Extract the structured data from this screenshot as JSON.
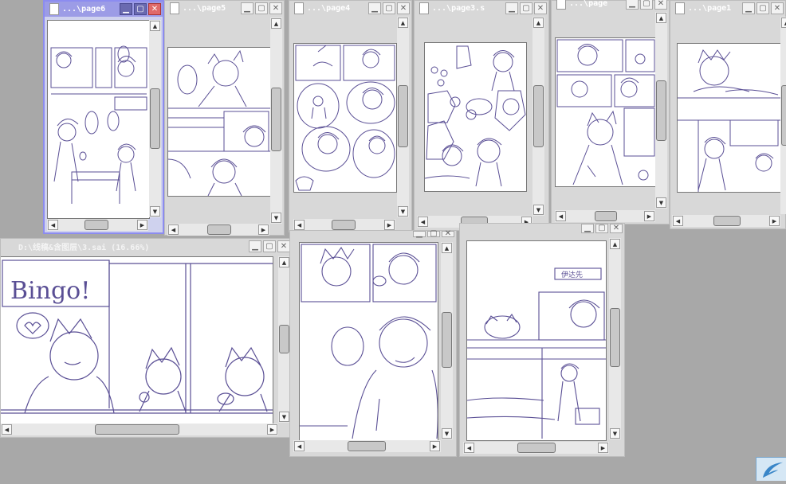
{
  "windows": [
    {
      "id": "page6",
      "title": "...\\page6",
      "active": true
    },
    {
      "id": "page5",
      "title": "...\\page5",
      "active": false
    },
    {
      "id": "page4",
      "title": "...\\page4",
      "active": false
    },
    {
      "id": "page3",
      "title": "...\\page3.s",
      "active": false
    },
    {
      "id": "page2",
      "title": "...\\page",
      "active": false
    },
    {
      "id": "page1",
      "title": "...\\page1",
      "active": false
    },
    {
      "id": "page3big",
      "title": "D:\\线稿&含图层\\3.sai (16.66%)",
      "active": false
    },
    {
      "id": "page7",
      "title": "",
      "active": false
    },
    {
      "id": "page8",
      "title": "",
      "active": false
    }
  ],
  "canvas_text": {
    "bingo": "Bingo!",
    "sign": "伊达先"
  },
  "colors": {
    "ink": "#5a4f95",
    "active_border": "#8c8cf0",
    "desktop": "#a8a8a8"
  },
  "icons": {
    "minimize": "minimize-icon",
    "maximize": "maximize-icon",
    "close": "close-icon",
    "app": "sai-logo-icon"
  }
}
